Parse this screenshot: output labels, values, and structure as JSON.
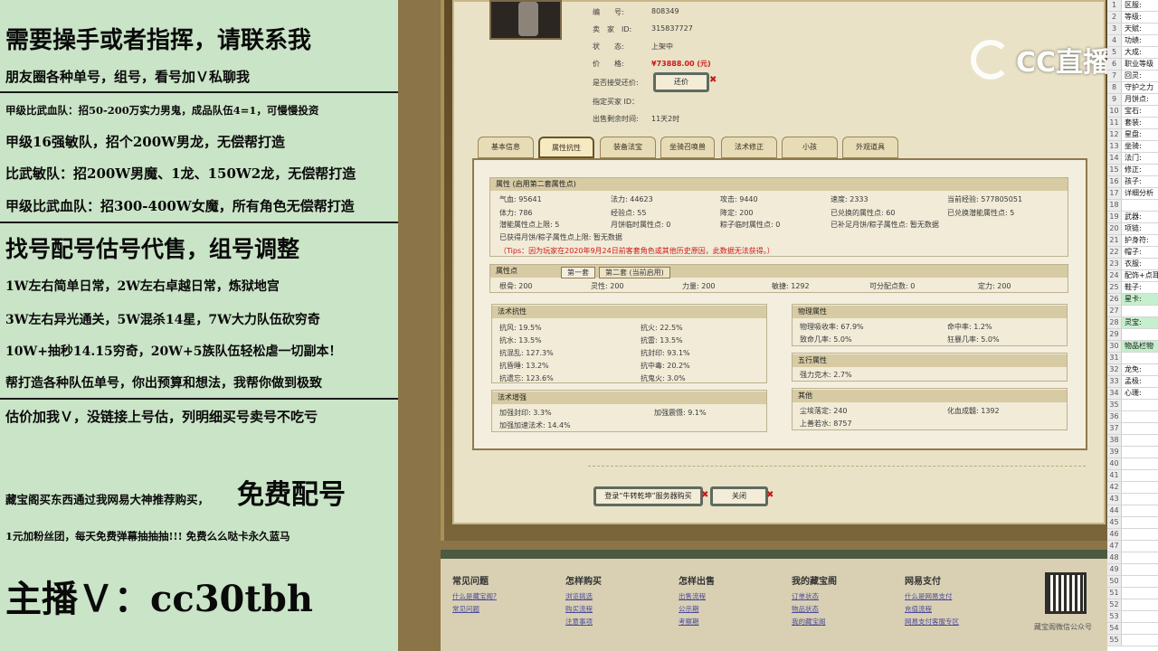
{
  "overlay_left": {
    "lines": [
      "需要操手或者指挥，请联系我",
      "朋友圈各种单号，组号，看号加Ｖ私聊我",
      "甲级比武血队：招50-200万实力男鬼，成品队伍4=1，可慢慢投资",
      "甲级16强敏队，招个200W男龙，无偿帮打造",
      "比武敏队：招200W男魔、1龙、150W2龙，无偿帮打造",
      "甲级比武血队：招300-400W女魔，所有角色无偿帮打造",
      "找号配号估号代售，组号调整",
      "1W左右简单日常，2W左右卓越日常，炼狱地宫",
      "3W左右异光通关，5W混杀14星，7W大力队伍砍穷奇",
      "10W+抽秒14.15穷奇，20W+5族队伍轻松虐一切副本！",
      "帮打造各种队伍单号，你出预算和想法，我帮你做到极致",
      "估价加我Ｖ，没链接上号估，列明细买号卖号不吃亏",
      "藏宝阁买东西通过我网易大神推荐购买，",
      "免费配号",
      "1元加粉丝团，每天免费弹幕抽抽抽!!! 免费么么哒卡永久蓝马",
      "主播Ｖ：cc30tbh"
    ]
  },
  "watermark": {
    "text": "CC直播"
  },
  "item_info": {
    "id_label": "编　　号:",
    "id_value": "808349",
    "seller_label": "卖　家　ID:",
    "seller_value": "315837727",
    "status_label": "状　　态:",
    "status_value": "上架中",
    "price_label": "价　　格:",
    "price_value": "¥73888.00 (元)",
    "counter_label": "是否接受还价:",
    "counter_button": "还价",
    "buyer_label": "指定买家 ID：",
    "time_label": "出售剩余时间:",
    "time_value": "11天2时"
  },
  "tabs": [
    "基本信息",
    "属性抗性",
    "装备法宝",
    "坐骑召唤兽",
    "法术修正",
    "小孩",
    "外观道具"
  ],
  "attr_section": {
    "title": "属性 (启用第二套属性点)",
    "rows": [
      [
        "气血: 95641",
        "法力: 44623",
        "攻击: 9440",
        "速度: 2333",
        "当前经验: 577805051"
      ],
      [
        "体力: 786",
        "经验点: 55",
        "降定: 200",
        "已兑换的属性点: 60",
        "已兑换潜能属性点: 5"
      ],
      [
        "潜能属性点上限: 5",
        "月饼临时属性点: 0",
        "粽子临时属性点: 0",
        "已补足月饼/粽子属性点: 暂无数据",
        ""
      ]
    ],
    "note1": "已获得月饼/粽子属性点上限: 暂无数据",
    "tips": "（Tips：因为玩家在2020年9月24日前客套角色或其他历史原因，此数据无法获得。）"
  },
  "points_section": {
    "title": "属性点",
    "subtab1": "第一套",
    "subtab2": "第二套 (当前启用)",
    "values": [
      "根骨: 200",
      "灵性: 200",
      "力量: 200",
      "敏捷: 1292",
      "可分配点数: 0",
      "定力: 200"
    ]
  },
  "resist_section": {
    "title": "法术抗性",
    "left": [
      "抗风: 19.5%",
      "抗水: 13.5%",
      "抗混乱: 127.3%",
      "抗昏睡: 13.2%",
      "抗遗忘: 123.6%"
    ],
    "right": [
      "抗火: 22.5%",
      "抗雷: 13.5%",
      "抗封印: 93.1%",
      "抗中毒: 20.2%",
      "抗鬼火: 3.0%"
    ]
  },
  "enhance_section": {
    "title": "法术增强",
    "items": [
      "加强封印: 3.3%",
      "加强震慑: 9.1%",
      "加强加速法术: 14.4%"
    ]
  },
  "phys_section": {
    "title": "物理属性",
    "items": [
      "物理吸收率: 67.9%",
      "命中率: 1.2%",
      "致命几率: 5.0%",
      "狂暴几率: 5.0%"
    ]
  },
  "wuxing_section": {
    "title": "五行属性",
    "items": [
      "强力克木: 2.7%"
    ]
  },
  "other_section": {
    "title": "其他",
    "items": [
      "尘埃落定: 240",
      "化血成髓: 1392",
      "上善若水: 8757"
    ]
  },
  "buttons": {
    "login": "登录“牛转乾坤”服务器购买",
    "close": "关闭"
  },
  "footer": {
    "cols": [
      {
        "title": "常见问题",
        "links": [
          "什么是藏宝阁?",
          "常见问题"
        ]
      },
      {
        "title": "怎样购买",
        "links": [
          "浏览挑选",
          "购买流程",
          "注意事项"
        ]
      },
      {
        "title": "怎样出售",
        "links": [
          "出售流程",
          "公示期",
          "考察期"
        ]
      },
      {
        "title": "我的藏宝阁",
        "links": [
          "订单状态",
          "物品状态",
          "我的藏宝阁"
        ]
      },
      {
        "title": "网易支付",
        "links": [
          "什么是网易支付",
          "充值流程",
          "网易支付客服专区"
        ]
      }
    ],
    "qr_caption": "藏宝阁微信公众号"
  },
  "sheet": {
    "rows": [
      [
        "1",
        "区服:"
      ],
      [
        "2",
        "等级:"
      ],
      [
        "3",
        "天赋:"
      ],
      [
        "4",
        "功绩:"
      ],
      [
        "5",
        "大成:"
      ],
      [
        "6",
        "职业等级"
      ],
      [
        "7",
        "回灵:"
      ],
      [
        "8",
        "守护之力"
      ],
      [
        "9",
        "月饼点:"
      ],
      [
        "10",
        "宝石:"
      ],
      [
        "11",
        "套装:"
      ],
      [
        "12",
        "星盘:"
      ],
      [
        "13",
        "坐骑:"
      ],
      [
        "14",
        "法门:"
      ],
      [
        "15",
        "修正:"
      ],
      [
        "16",
        "孩子:"
      ],
      [
        "17",
        "详细分析"
      ],
      [
        "18",
        ""
      ],
      [
        "19",
        "武器:"
      ],
      [
        "20",
        "项链:"
      ],
      [
        "21",
        "护身符:"
      ],
      [
        "22",
        "帽子:"
      ],
      [
        "23",
        "衣服:"
      ],
      [
        "24",
        "配饰+点耳"
      ],
      [
        "25",
        "鞋子:"
      ],
      [
        "26",
        "星卡:"
      ],
      [
        "27",
        ""
      ],
      [
        "28",
        "灵宝:"
      ],
      [
        "29",
        ""
      ],
      [
        "30",
        "物品栏物"
      ],
      [
        "31",
        ""
      ],
      [
        "32",
        "龙免:"
      ],
      [
        "33",
        "孟极:"
      ],
      [
        "34",
        "心珊:"
      ],
      [
        "35",
        ""
      ],
      [
        "36",
        ""
      ],
      [
        "37",
        ""
      ],
      [
        "38",
        ""
      ],
      [
        "39",
        ""
      ],
      [
        "40",
        ""
      ],
      [
        "41",
        ""
      ],
      [
        "42",
        ""
      ],
      [
        "43",
        ""
      ],
      [
        "44",
        ""
      ],
      [
        "45",
        ""
      ],
      [
        "46",
        ""
      ],
      [
        "47",
        ""
      ],
      [
        "48",
        ""
      ],
      [
        "49",
        ""
      ],
      [
        "50",
        ""
      ],
      [
        "51",
        ""
      ],
      [
        "52",
        ""
      ],
      [
        "53",
        ""
      ],
      [
        "54",
        ""
      ],
      [
        "55",
        ""
      ]
    ]
  },
  "colors": {
    "price": "#d0161a",
    "overlay_bg": "#c9e4c6",
    "sheet_highlight": "#c6efcd"
  }
}
